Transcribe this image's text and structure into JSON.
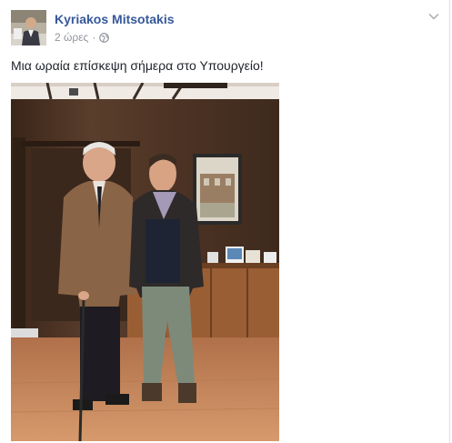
{
  "post": {
    "author": "Kyriakos Mitsotakis",
    "timestamp": "2 ώρες",
    "separator": "·",
    "privacy_icon": "globe-icon",
    "text": "Μια ωραία επίσκεψη σήμερα στο Υπουργείο!",
    "menu_icon": "chevron-down-icon",
    "photo": "two-men-standing-in-office"
  },
  "colors": {
    "author_link": "#365899",
    "meta_text": "#90949c",
    "body_text": "#1d2129"
  }
}
